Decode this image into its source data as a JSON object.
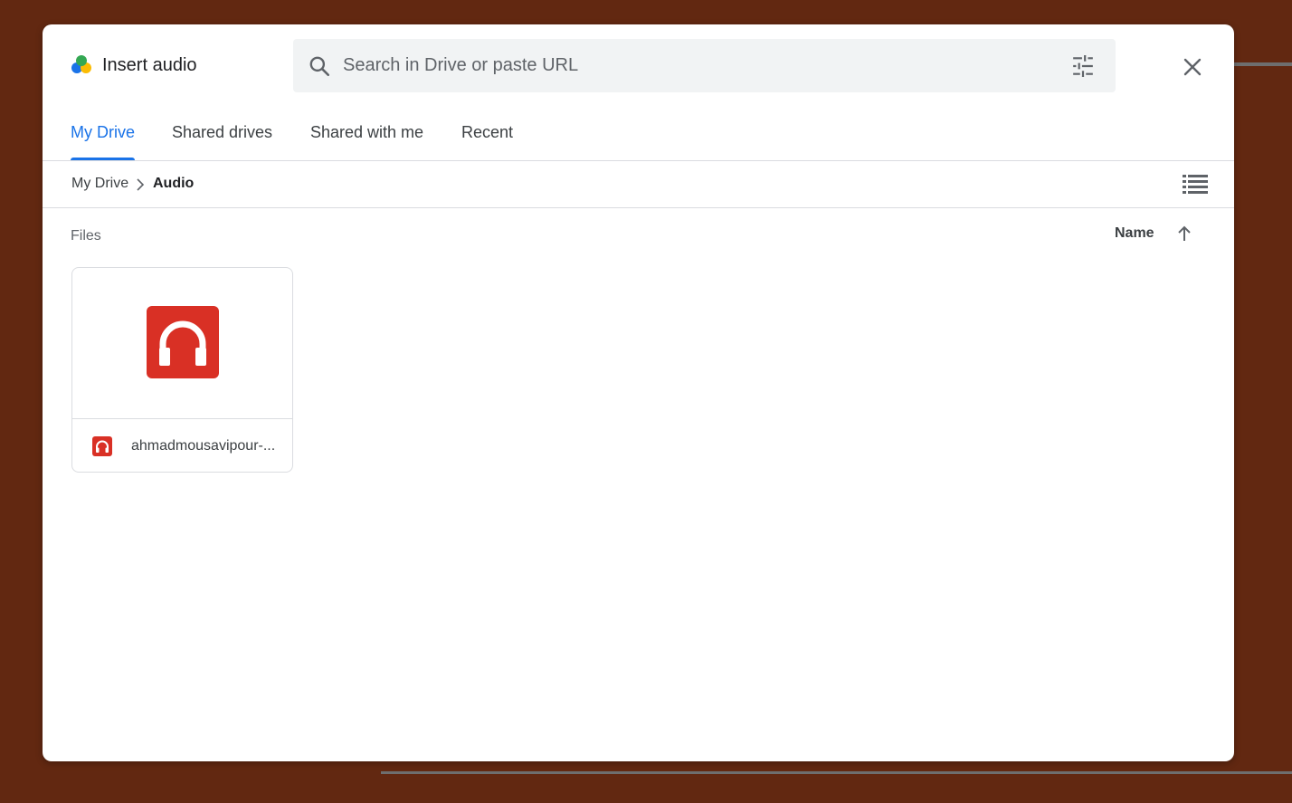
{
  "dialog": {
    "title": "Insert audio",
    "logo_icon": "google-drive-icon"
  },
  "search": {
    "placeholder": "Search in Drive or paste URL",
    "value": "",
    "search_icon": "search-icon",
    "filter_icon": "tune-icon"
  },
  "close": {
    "icon": "close-icon"
  },
  "tabs": [
    {
      "label": "My Drive",
      "active": true
    },
    {
      "label": "Shared drives",
      "active": false
    },
    {
      "label": "Shared with me",
      "active": false
    },
    {
      "label": "Recent",
      "active": false
    }
  ],
  "breadcrumb": {
    "items": [
      "My Drive",
      "Audio"
    ],
    "separator_icon": "chevron-right-icon"
  },
  "view_toggle": {
    "icon": "list-view-icon"
  },
  "files_section": {
    "label": "Files",
    "sort_label": "Name",
    "sort_icon": "arrow-up-icon"
  },
  "files": [
    {
      "name": "ahmadmousavipour-...",
      "type_icon": "audio-file-icon"
    }
  ],
  "colors": {
    "accent": "#1a73e8",
    "audio_red": "#d93025",
    "background": "#622811"
  }
}
